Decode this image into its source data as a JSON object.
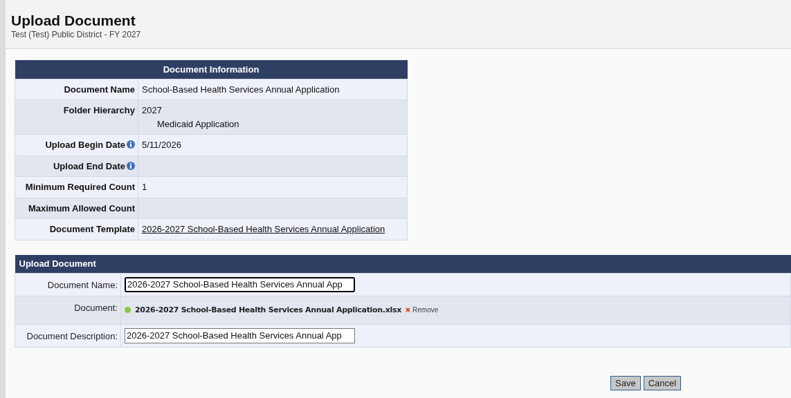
{
  "header": {
    "title": "Upload Document",
    "subtitle": "Test (Test) Public District - FY 2027"
  },
  "document_information": {
    "title": "Document Information",
    "rows": [
      {
        "label": "Document Name",
        "info": false,
        "kind": "text",
        "values": [
          "School-Based Health Services Annual Application"
        ]
      },
      {
        "label": "Folder Hierarchy",
        "info": false,
        "kind": "tree",
        "values": [
          "2027",
          "Medicaid Application"
        ]
      },
      {
        "label": "Upload Begin Date",
        "info": true,
        "kind": "text",
        "values": [
          "5/11/2026"
        ]
      },
      {
        "label": "Upload End Date",
        "info": true,
        "kind": "text",
        "values": []
      },
      {
        "label": "Minimum Required Count",
        "info": false,
        "kind": "text",
        "values": [
          "1"
        ]
      },
      {
        "label": "Maximum Allowed Count",
        "info": false,
        "kind": "text",
        "values": []
      },
      {
        "label": "Document Template",
        "info": false,
        "kind": "link",
        "values": [
          "2026-2027 School-Based Health Services Annual Application"
        ]
      }
    ]
  },
  "upload_document": {
    "title": "Upload Document",
    "rows": [
      {
        "label": "Document Name:",
        "kind": "input",
        "value": "2026-2027 School-Based Health Services Annual App",
        "focused": true
      },
      {
        "label": "Document:",
        "kind": "file",
        "file_name": "2026-2027 School-Based Health Services Annual Application.xlsx",
        "remove": "Remove"
      },
      {
        "label": "Document Description:",
        "kind": "input",
        "value": "2026-2027 School-Based Health Services Annual App",
        "focused": false
      }
    ]
  },
  "buttons": [
    "Save",
    "Cancel"
  ]
}
